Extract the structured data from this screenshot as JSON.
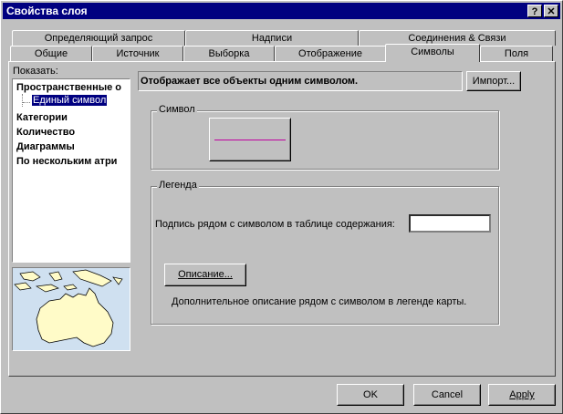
{
  "window": {
    "title": "Свойства слоя",
    "help_btn": "?",
    "close_btn": "✕"
  },
  "tabs_back": [
    {
      "label": "Определяющий запрос"
    },
    {
      "label": "Надписи"
    },
    {
      "label": "Соединения & Связи"
    }
  ],
  "tabs_front": [
    {
      "label": "Общие"
    },
    {
      "label": "Источник"
    },
    {
      "label": "Выборка"
    },
    {
      "label": "Отображение"
    },
    {
      "label": "Символы"
    },
    {
      "label": "Поля"
    }
  ],
  "active_tab": "Символы",
  "left": {
    "show_label": "Показать:",
    "tree": [
      {
        "label": "Пространственные о"
      },
      {
        "label": "Единый символ"
      },
      {
        "label": "Категории"
      },
      {
        "label": "Количество"
      },
      {
        "label": "Диаграммы"
      },
      {
        "label": "По нескольким атри"
      }
    ],
    "selected": "Единый символ"
  },
  "main": {
    "description": "Отображает все объекты одним символом.",
    "import_btn": "Импорт...",
    "symbol_group": "Символ",
    "symbol_color": "#c000a0",
    "legend_group": "Легенда",
    "caption_label": "Подпись рядом с символом в таблице содержания:",
    "caption_value": "",
    "description_btn": "Описание...",
    "description_hint": "Дополнительное описание рядом с символом в легенде карты."
  },
  "footer": {
    "ok": "OK",
    "cancel": "Cancel",
    "apply": "Apply"
  },
  "colors": {
    "titlebar": "#000080",
    "selection": "#000080",
    "land": "#fffbc8",
    "water": "#cfe0f0"
  }
}
